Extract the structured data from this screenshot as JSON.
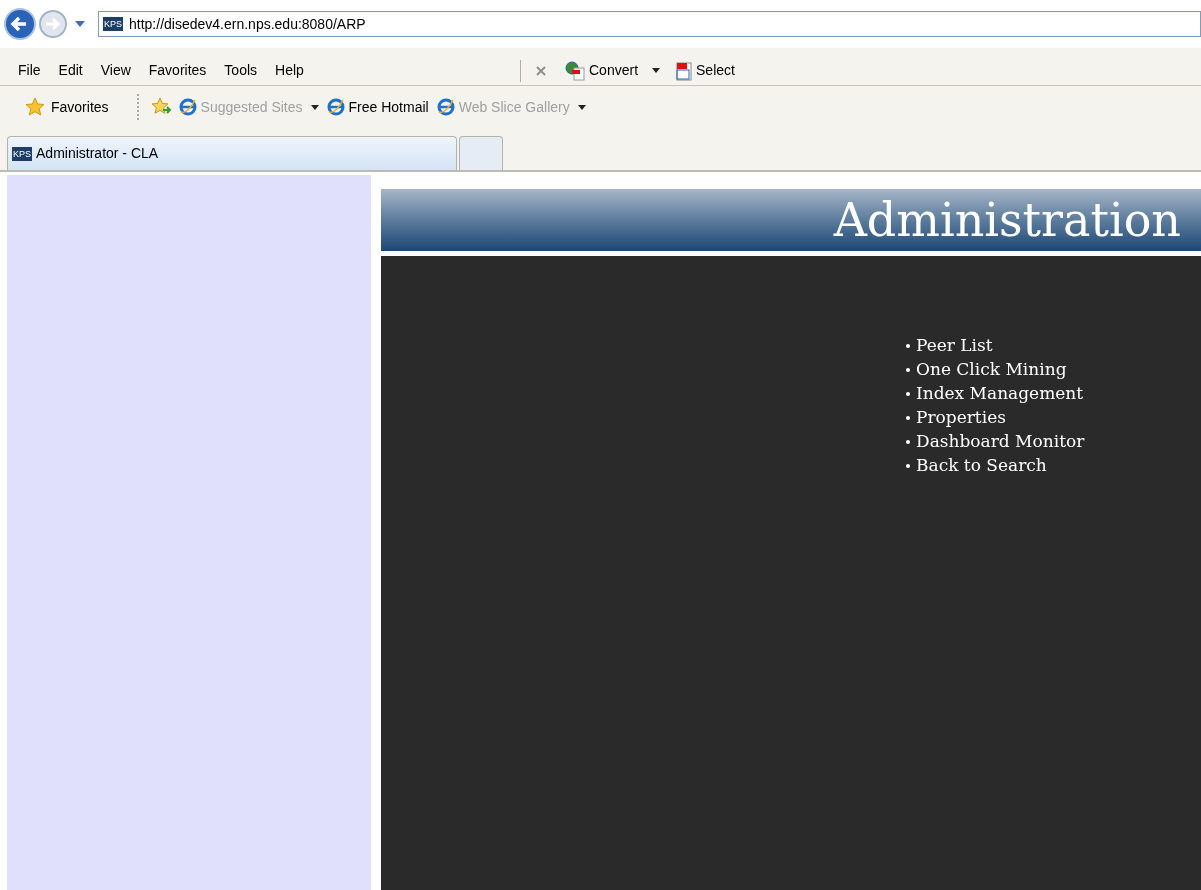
{
  "address_bar": {
    "url": "http://disedev4.ern.nps.edu:8080/ARP",
    "favicon": "KPS"
  },
  "menu_bar": [
    "File",
    "Edit",
    "View",
    "Favorites",
    "Tools",
    "Help"
  ],
  "command_bar": [
    {
      "label": "Convert",
      "kind": "convert"
    },
    {
      "label": "Select",
      "kind": "select"
    }
  ],
  "favorites_bar": {
    "label": "Favorites",
    "items": [
      {
        "label": "Suggested Sites",
        "disabled": true,
        "dropdown": true
      },
      {
        "label": "Free Hotmail",
        "disabled": false,
        "dropdown": false
      },
      {
        "label": "Web Slice Gallery",
        "disabled": true,
        "dropdown": true
      }
    ]
  },
  "tabs": [
    {
      "label": "Administrator - CLA",
      "favicon": "KPS",
      "selected": true
    },
    {
      "selected": false
    }
  ],
  "page": {
    "header": "Administration",
    "links": [
      "Peer List",
      "One Click Mining",
      "Index Management",
      "Properties",
      "Dashboard Monitor",
      "Back to Search"
    ]
  }
}
